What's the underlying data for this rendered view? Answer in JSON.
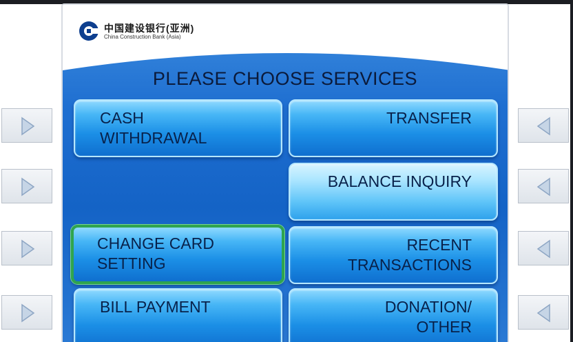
{
  "bank": {
    "name_cn": "中国建设银行(亚洲)",
    "name_en": "China Construction Bank (Asia)"
  },
  "screen": {
    "title": "PLEASE CHOOSE SERVICES"
  },
  "services": {
    "cash_withdrawal": [
      "CASH",
      "WITHDRAWAL"
    ],
    "transfer": "TRANSFER",
    "balance_inquiry": "BALANCE INQUIRY",
    "change_card_setting": [
      "CHANGE CARD",
      "SETTING"
    ],
    "recent_transactions": [
      "RECENT",
      "TRANSACTIONS"
    ],
    "bill_payment": "BILL PAYMENT",
    "donation_other": [
      "DONATION/",
      "OTHER"
    ]
  },
  "selected_service": "change_card_setting",
  "colors": {
    "panel_blue": "#1463c6",
    "button_blue": "#1b8fe6",
    "selection_green": "#2fa44f",
    "text_dark": "#08214a"
  },
  "icons": {
    "left_keys": "triangle-right-icon",
    "right_keys": "triangle-left-icon",
    "logo": "ccb-logo-icon"
  }
}
